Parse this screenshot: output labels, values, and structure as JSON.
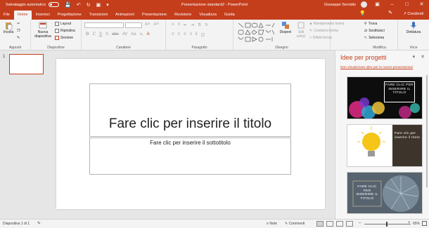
{
  "titlebar": {
    "autosave_label": "Salvataggio automatico",
    "doc_title": "Presentazione standard2  -  PowerPoint",
    "user_name": "Giuseppe Servidio"
  },
  "tabs": [
    {
      "label": "File"
    },
    {
      "label": "Home",
      "active": true
    },
    {
      "label": "Inserisci"
    },
    {
      "label": "Progettazione"
    },
    {
      "label": "Transizioni"
    },
    {
      "label": "Animazioni"
    },
    {
      "label": "Presentazione"
    },
    {
      "label": "Revisione"
    },
    {
      "label": "Visualizza"
    },
    {
      "label": "Guida"
    }
  ],
  "share_label": "Condividi",
  "ribbon": {
    "clipboard": {
      "paste_label": "Incolla",
      "group_label": "Appunti"
    },
    "slides": {
      "new_slide_label": "Nuova diapositiva",
      "layout_label": "Layout",
      "reset_label": "Ripristina",
      "section_label": "Sezione",
      "group_label": "Diapositive"
    },
    "font": {
      "group_label": "Carattere"
    },
    "paragraph": {
      "group_label": "Paragrafo"
    },
    "drawing": {
      "arrange_label": "Disponi",
      "quick_styles_label": "Stili veloci",
      "shape_fill_label": "Riempimento forma",
      "shape_outline_label": "Contorno forma",
      "shape_effects_label": "Effetti forma",
      "group_label": "Disegno"
    },
    "editing": {
      "find_label": "Trova",
      "replace_label": "Sostituisci",
      "select_label": "Seleziona",
      "group_label": "Modifica"
    },
    "voice": {
      "dictate_label": "Dettatura",
      "group_label": "Voce"
    }
  },
  "thumbnails": [
    {
      "number": "1"
    }
  ],
  "slide": {
    "title_placeholder": "Fare clic per inserire il titolo",
    "subtitle_placeholder": "Fare clic per inserire il sottotitolo"
  },
  "design_ideas": {
    "title": "Idee per progetti",
    "dismiss_link": "Non visualizzare idee per le nuove presentazioni",
    "cards": [
      {
        "text": "FARE CLIC PER INSERIRE IL TITOLO"
      },
      {
        "text": "Fare clic per inserire il titolo"
      },
      {
        "text": "FARE CLIC PER INSERIRE IL TITOLO"
      }
    ]
  },
  "statusbar": {
    "slide_info": "Diapositiva 1 di 1",
    "notes_label": "Note",
    "comments_label": "Commenti",
    "zoom": "65%"
  },
  "colors": {
    "accent": "#c43e1c",
    "ribbon_bg": "#f3f3f3",
    "canvas_bg": "#e6e6e6"
  }
}
